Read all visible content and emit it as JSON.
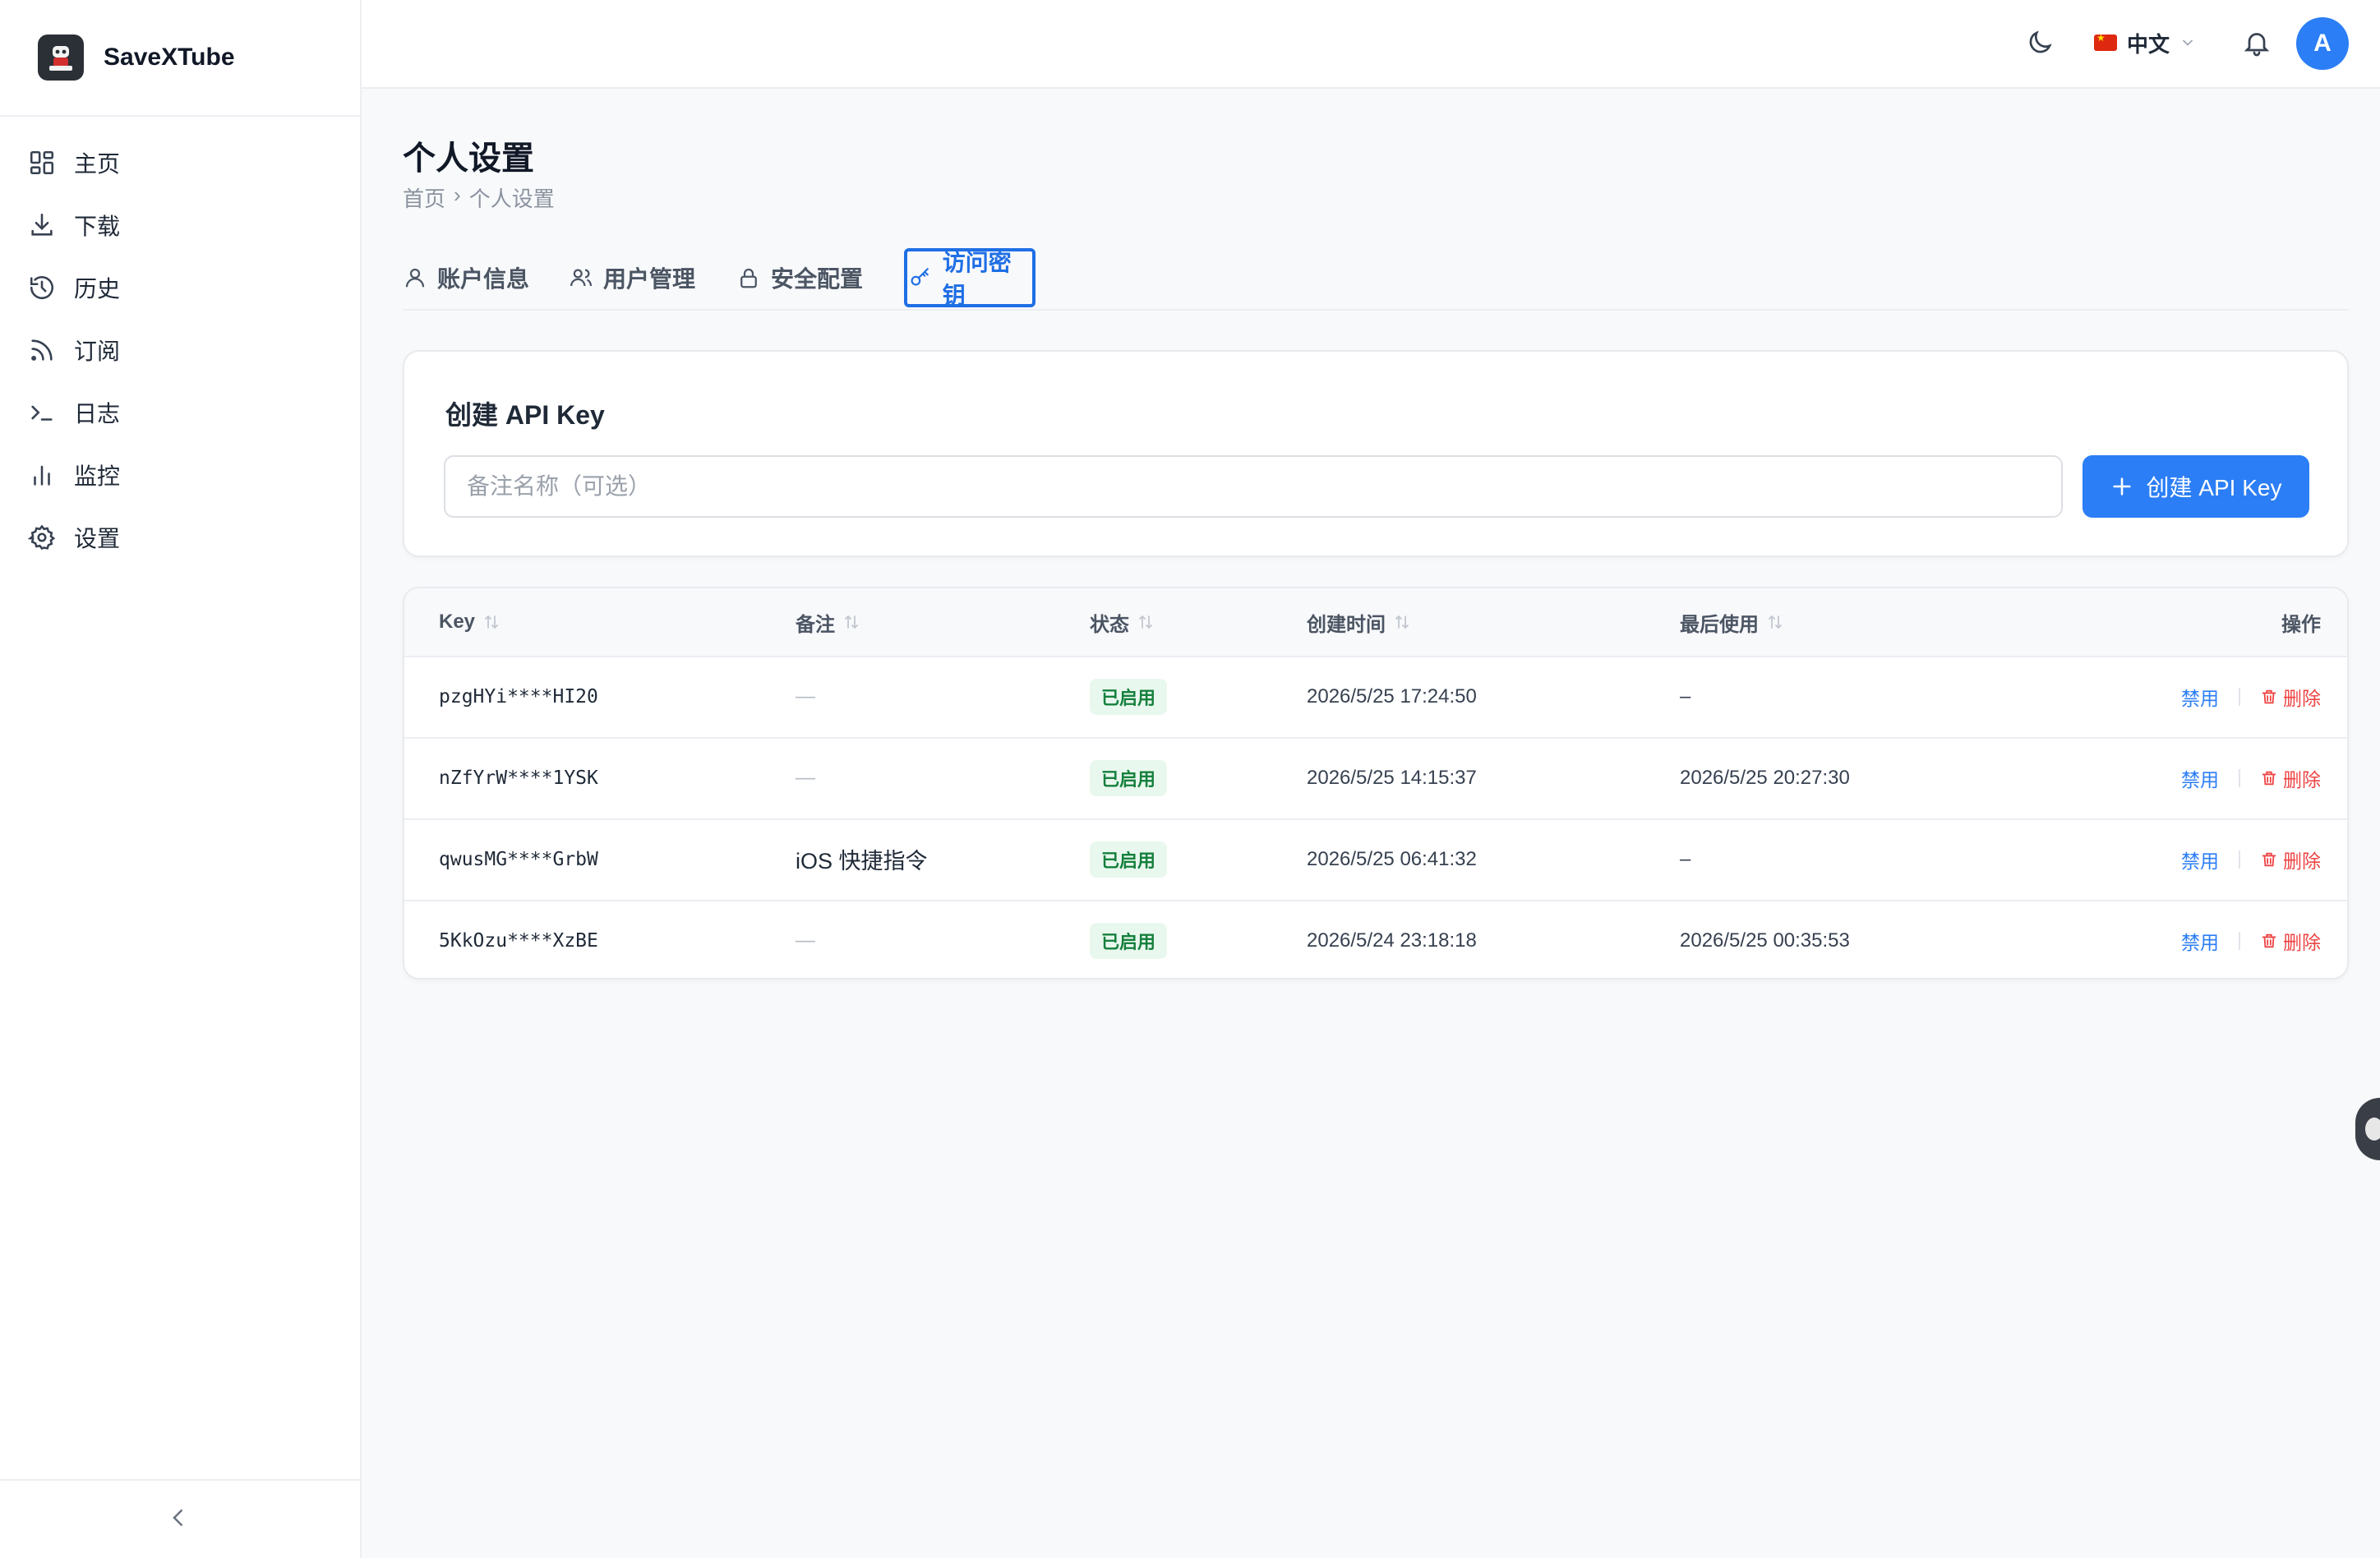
{
  "app": {
    "name": "SaveXTube"
  },
  "sidebar": {
    "items": [
      {
        "label": "主页",
        "icon": "dashboard-icon"
      },
      {
        "label": "下载",
        "icon": "download-icon"
      },
      {
        "label": "历史",
        "icon": "history-icon"
      },
      {
        "label": "订阅",
        "icon": "rss-icon"
      },
      {
        "label": "日志",
        "icon": "terminal-icon"
      },
      {
        "label": "监控",
        "icon": "bar-chart-icon"
      },
      {
        "label": "设置",
        "icon": "gear-icon"
      }
    ]
  },
  "header": {
    "language": "中文",
    "avatar_initial": "A"
  },
  "page": {
    "title": "个人设置",
    "breadcrumb": {
      "home": "首页",
      "separator": "›",
      "current": "个人设置"
    }
  },
  "tabs": [
    {
      "label": "账户信息",
      "icon": "user-icon",
      "active": false
    },
    {
      "label": "用户管理",
      "icon": "users-icon",
      "active": false
    },
    {
      "label": "安全配置",
      "icon": "lock-icon",
      "active": false
    },
    {
      "label": "访问密钥",
      "icon": "key-icon",
      "active": true
    }
  ],
  "create_card": {
    "title": "创建 API Key",
    "input_placeholder": "备注名称（可选）",
    "input_value": "",
    "button_label": "创建 API Key"
  },
  "table": {
    "headers": {
      "key": "Key",
      "note": "备注",
      "status": "状态",
      "created": "创建时间",
      "last_used": "最后使用",
      "actions": "操作"
    },
    "rows": [
      {
        "key": "pzgHYi****HI20",
        "note": "—",
        "status": "已启用",
        "created": "2026/5/25 17:24:50",
        "last_used": "–",
        "disable": "禁用",
        "delete": "删除"
      },
      {
        "key": "nZfYrW****1YSK",
        "note": "—",
        "status": "已启用",
        "created": "2026/5/25 14:15:37",
        "last_used": "2026/5/25 20:27:30",
        "disable": "禁用",
        "delete": "删除"
      },
      {
        "key": "qwusMG****GrbW",
        "note": "iOS 快捷指令",
        "status": "已启用",
        "created": "2026/5/25 06:41:32",
        "last_used": "–",
        "disable": "禁用",
        "delete": "删除"
      },
      {
        "key": "5KkOzu****XzBE",
        "note": "—",
        "status": "已启用",
        "created": "2026/5/24 23:18:18",
        "last_used": "2026/5/25 00:35:53",
        "disable": "禁用",
        "delete": "删除"
      }
    ]
  },
  "colors": {
    "accent": "#2b7ef5",
    "active_tab": "#1f6fe5",
    "status_enabled_bg": "#e9f8ee",
    "status_enabled_text": "#15803d",
    "danger": "#ef4444"
  }
}
